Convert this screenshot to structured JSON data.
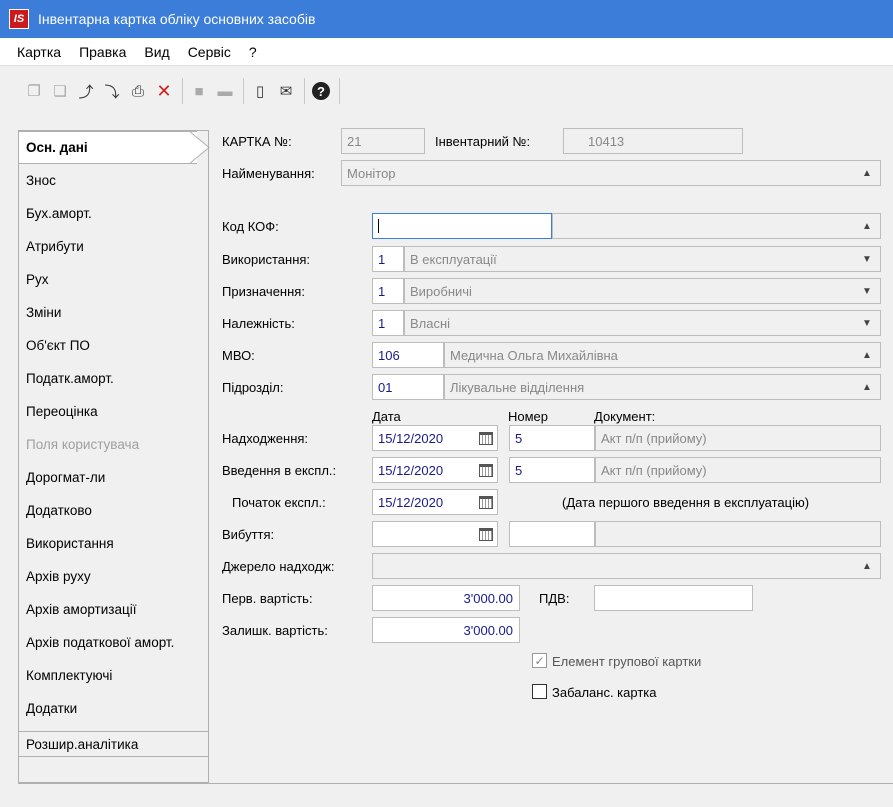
{
  "window": {
    "title": "Інвентарна картка обліку основних засобів",
    "logo": "IS"
  },
  "menu": [
    "Картка",
    "Правка",
    "Вид",
    "Сервіс",
    "?"
  ],
  "toolbar": {
    "icons": [
      "copy-icon",
      "paste-icon",
      "undo-icon",
      "redo-icon",
      "print-icon",
      "delete-icon",
      "grid-icon",
      "window-icon",
      "document-icon",
      "mail-icon",
      "help-icon"
    ]
  },
  "sidebar": {
    "items": [
      {
        "label": "Осн. дані",
        "active": true
      },
      {
        "label": "Знос"
      },
      {
        "label": "Бух.аморт."
      },
      {
        "label": "Атрибути"
      },
      {
        "label": "Рух"
      },
      {
        "label": "Зміни"
      },
      {
        "label": "Об'єкт ПО"
      },
      {
        "label": "Податк.аморт."
      },
      {
        "label": "Переоцінка"
      },
      {
        "label": "Поля користувача",
        "disabled": true
      },
      {
        "label": "Дорогмат-ли"
      },
      {
        "label": "Додатково"
      },
      {
        "label": "Використання"
      },
      {
        "label": "Архів руху"
      },
      {
        "label": "Архів амортизації"
      },
      {
        "label": "Архів податкової аморт."
      },
      {
        "label": "Комплектуючі"
      },
      {
        "label": "Додатки"
      },
      {
        "label": "Розшир.аналітика"
      }
    ]
  },
  "form": {
    "card_no_label": "КАРТКА №:",
    "card_no": "21",
    "inv_no_label": "Інвентарний №:",
    "inv_no": "10413",
    "name_label": "Найменування:",
    "name": "Монітор",
    "kof_label": "Код КОФ:",
    "usage_label": "Використання:",
    "usage_code": "1",
    "usage_name": "В експлуатації",
    "purpose_label": "Призначення:",
    "purpose_code": "1",
    "purpose_name": "Виробничі",
    "belonging_label": "Належність:",
    "belonging_code": "1",
    "belonging_name": "Власні",
    "mvo_label": "МВО:",
    "mvo_code": "106",
    "mvo_name": "Медична Ольга Михайлівна",
    "dept_label": "Підрозділ:",
    "dept_code": "01",
    "dept_name": "Лікувальне відділення",
    "col_date": "Дата",
    "col_number": "Номер",
    "col_document": "Документ:",
    "receipt_label": "Надходження:",
    "receipt_date": "15/12/2020",
    "receipt_number": "5",
    "receipt_doc": "Акт п/п (прийому)",
    "commission_label": "Введення в експл.:",
    "commission_date": "15/12/2020",
    "commission_number": "5",
    "commission_doc": "Акт п/п (прийому)",
    "start_label": "Початок експл.:",
    "start_date": "15/12/2020",
    "start_note": "(Дата першого введення в експлуатацію)",
    "disposal_label": "Вибуття:",
    "source_label": "Джерело надходж:",
    "initial_cost_label": "Перв. вартість:",
    "initial_cost": "3'000.00",
    "vat_label": "ПДВ:",
    "residual_cost_label": "Залишк. вартість:",
    "residual_cost": "3'000.00",
    "group_element_label": "Елемент групової картки",
    "group_element_checked": true,
    "offbalance_label": "Забаланс.  картка",
    "offbalance_checked": false
  }
}
